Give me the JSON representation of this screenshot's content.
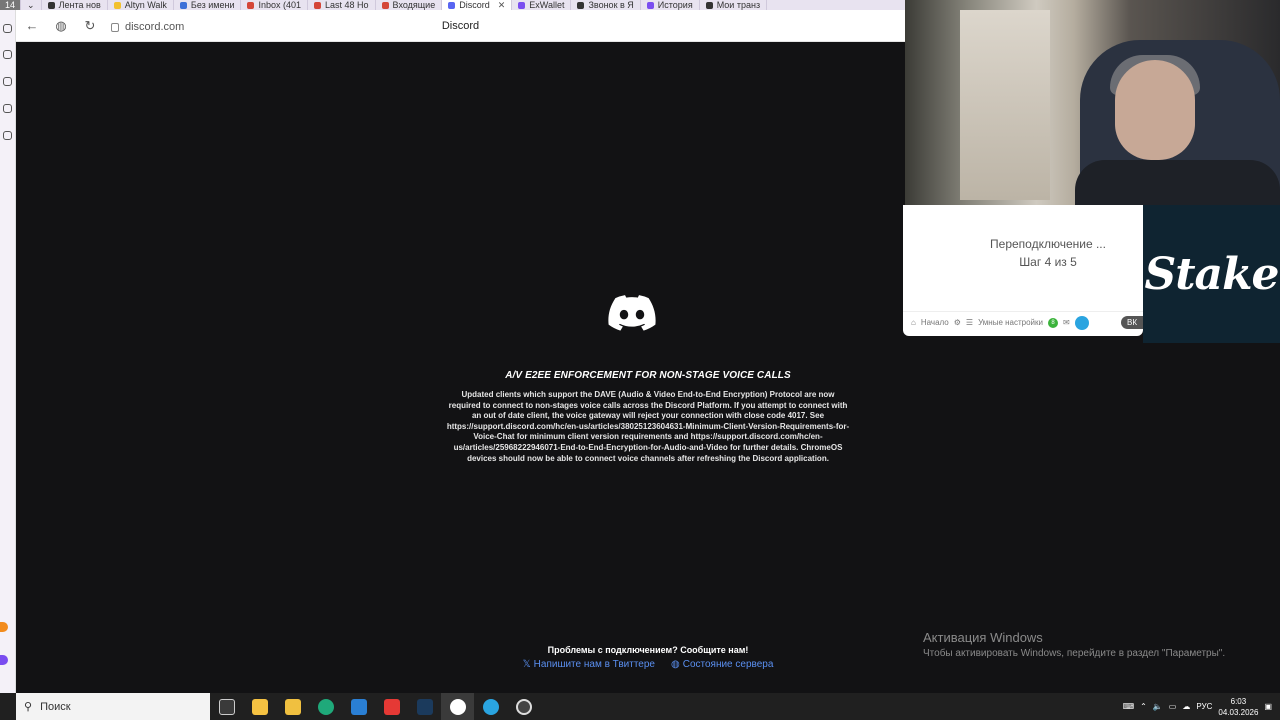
{
  "browser": {
    "tab_count": "14",
    "tabs": [
      {
        "label": "Лента нов",
        "color": "#333333"
      },
      {
        "label": "Altyn Walk",
        "color": "#f2c12e"
      },
      {
        "label": "Без имени",
        "color": "#3d6fd8"
      },
      {
        "label": "Inbox (401",
        "color": "#d44638"
      },
      {
        "label": "Last 48 Ho",
        "color": "#d44638"
      },
      {
        "label": "Входящие",
        "color": "#d44638"
      },
      {
        "label": "Discord",
        "color": "#5865f2",
        "active": true
      },
      {
        "label": "ExWallet",
        "color": "#7a4df0"
      },
      {
        "label": "Звонок в Я",
        "color": "#333333"
      },
      {
        "label": "История",
        "color": "#7a4df0"
      },
      {
        "label": "Мои транз",
        "color": "#333333"
      }
    ],
    "url": "discord.com",
    "page_title": "Discord"
  },
  "discord": {
    "notice_title": "A/V E2EE ENFORCEMENT FOR NON-STAGE VOICE CALLS",
    "notice_body": "Updated clients which support the DAVE (Audio & Video End-to-End Encryption) Protocol are now required to connect to non-stages voice calls across the Discord Platform. If you attempt to connect with an out of date client, the voice gateway will reject your connection with close code 4017. See https://support.discord.com/hc/en-us/articles/38025123604631-Minimum-Client-Version-Requirements-for-Voice-Chat for minimum client version requirements and https://support.discord.com/hc/en-us/articles/25968222946071-End-to-End-Encryption-for-Audio-and-Video for further details. ChromeOS devices should now be able to connect voice channels after refreshing the Discord application.",
    "footer_question": "Проблемы с подключением? Сообщите нам!",
    "twitter_link": "Напишите нам в Твиттере",
    "status_link": "Состояние сервера"
  },
  "widget": {
    "status": "Переподключение ...",
    "step": "Шаг 4 из 5",
    "bar_home": "Начало",
    "bar_settings": "Умные настройки",
    "badge": "8",
    "vk": "ВК"
  },
  "stake": {
    "logo_text": "Stake"
  },
  "activation": {
    "title": "Активация Windows",
    "text": "Чтобы активировать Windows, перейдите в раздел \"Параметры\"."
  },
  "taskbar": {
    "search_placeholder": "Поиск",
    "lang": "РУС",
    "time": "6:03",
    "date": "04.03.2026"
  },
  "colors": {
    "discord_bg": "#121214",
    "link": "#5a8ff0",
    "stake_bg": "#0f2431"
  }
}
